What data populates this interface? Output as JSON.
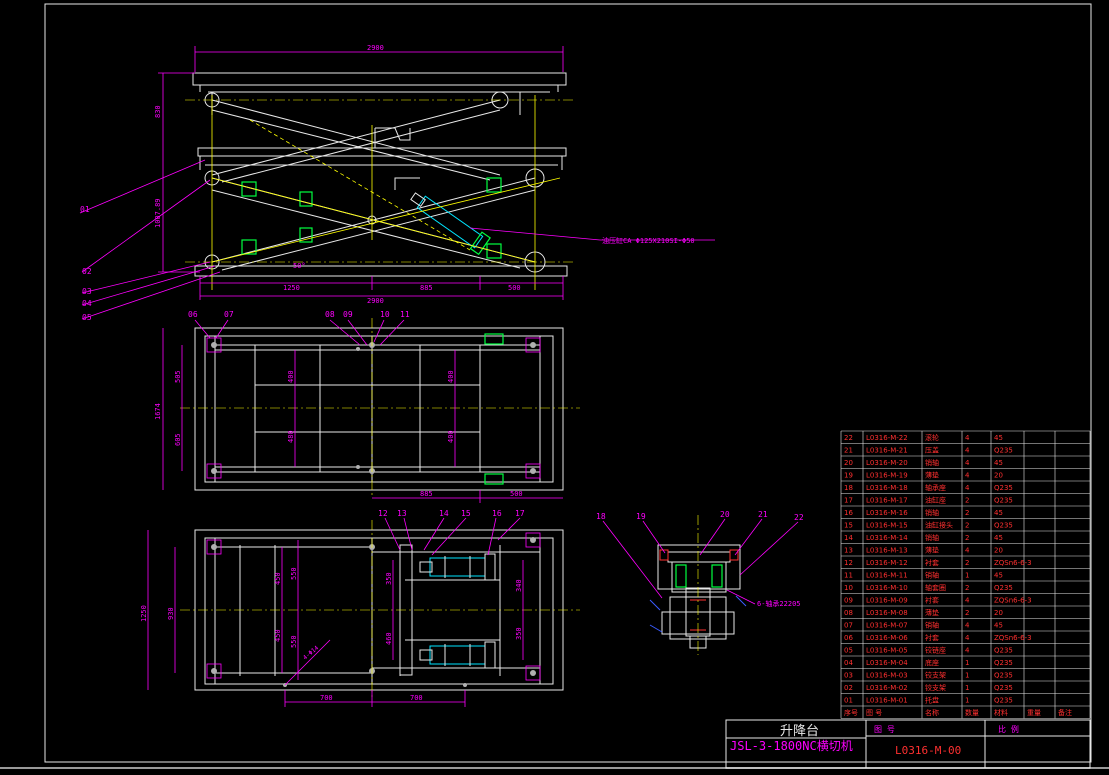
{
  "drawing": {
    "title_cn": "升降台",
    "model": "JSL-3-1800NC横切机",
    "drawing_no": "L0316-M-00",
    "tb_label_drawing_no": "图 号",
    "tb_label_scale": "比 例",
    "hydraulic_note": "油压缸CA Φ125X210SI-Φ50",
    "bearing_note": "6-轴承22205"
  },
  "side_view": {
    "dims": {
      "top_width": "2900",
      "bottom_width": "2900",
      "height_upper": "830",
      "height_lower": "1007.89",
      "seg1": "1250",
      "seg2": "885",
      "seg3": "500",
      "angle": "50°"
    },
    "callouts": [
      "01",
      "02",
      "03",
      "04",
      "05"
    ]
  },
  "top_view": {
    "dims": {
      "depth": "1674",
      "d1": "505",
      "d2": "605",
      "in1": "400",
      "in2": "480",
      "in3": "400",
      "in4": "400",
      "seg2": "885",
      "seg3": "500"
    },
    "callouts": [
      "06",
      "07",
      "08",
      "09",
      "10",
      "11"
    ]
  },
  "bottom_view": {
    "dims": {
      "depth": "1250",
      "d930": "930",
      "v1": "450",
      "v2": "450",
      "v3": "550",
      "v4": "550",
      "v5": "350",
      "v6": "460",
      "v7": "340",
      "v8": "350",
      "w1": "700",
      "w2": "700",
      "angle": "4-Φ14"
    },
    "callouts": [
      "12",
      "13",
      "14",
      "15",
      "16",
      "17"
    ]
  },
  "section_view": {
    "callouts": [
      "18",
      "19",
      "20",
      "21",
      "22"
    ]
  },
  "bom": {
    "headers": [
      "序号",
      "图 号",
      "名称",
      "数量",
      "材料",
      "重量",
      "备注"
    ],
    "rows": [
      [
        "22",
        "L0316-M-22",
        "滚轮",
        "4",
        "45"
      ],
      [
        "21",
        "L0316-M-21",
        "压盖",
        "4",
        "Q235"
      ],
      [
        "20",
        "L0316-M-20",
        "销轴",
        "4",
        "45"
      ],
      [
        "19",
        "L0316-M-19",
        "薄垫",
        "4",
        "20"
      ],
      [
        "18",
        "L0316-M-18",
        "轴承座",
        "4",
        "Q235"
      ],
      [
        "17",
        "L0316-M-17",
        "油缸座",
        "2",
        "Q235"
      ],
      [
        "16",
        "L0316-M-16",
        "销轴",
        "2",
        "45"
      ],
      [
        "15",
        "L0316-M-15",
        "油缸接头",
        "2",
        "Q235"
      ],
      [
        "14",
        "L0316-M-14",
        "销轴",
        "2",
        "45"
      ],
      [
        "13",
        "L0316-M-13",
        "薄垫",
        "4",
        "20"
      ],
      [
        "12",
        "L0316-M-12",
        "衬套",
        "2",
        "ZQSn6-6-3"
      ],
      [
        "11",
        "L0316-M-11",
        "销轴",
        "1",
        "45"
      ],
      [
        "10",
        "L0316-M-10",
        "轴套圈",
        "2",
        "Q235"
      ],
      [
        "09",
        "L0316-M-09",
        "衬套",
        "4",
        "ZQSn6-6-3"
      ],
      [
        "08",
        "L0316-M-08",
        "薄垫",
        "2",
        "20"
      ],
      [
        "07",
        "L0316-M-07",
        "销轴",
        "4",
        "45"
      ],
      [
        "06",
        "L0316-M-06",
        "衬套",
        "4",
        "ZQSn6-6-3"
      ],
      [
        "05",
        "L0316-M-05",
        "铰链座",
        "4",
        "Q235"
      ],
      [
        "04",
        "L0316-M-04",
        "底座",
        "1",
        "Q235"
      ],
      [
        "03",
        "L0316-M-03",
        "铰支架",
        "1",
        "Q235"
      ],
      [
        "02",
        "L0316-M-02",
        "铰支架",
        "1",
        "Q235"
      ],
      [
        "01",
        "L0316-M-01",
        "托盘",
        "1",
        "Q235"
      ]
    ]
  }
}
